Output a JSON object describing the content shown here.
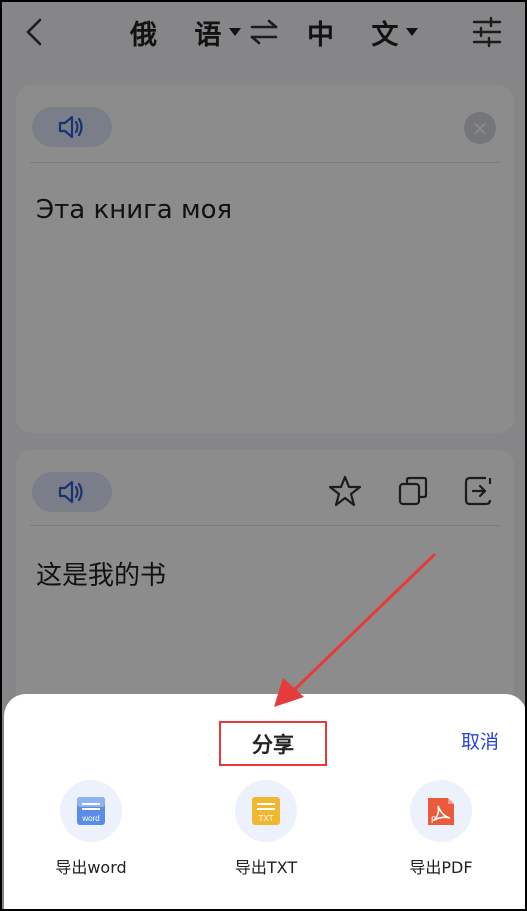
{
  "header": {
    "source_lang": "俄 语",
    "target_lang": "中 文"
  },
  "source": {
    "text": "Эта книга моя",
    "clear_symbol": "×"
  },
  "target": {
    "text": "这是我的书"
  },
  "share_sheet": {
    "title": "分享",
    "cancel": "取消",
    "options": [
      {
        "label": "导出word",
        "badge": "word",
        "color": "#5b8de8"
      },
      {
        "label": "导出TXT",
        "badge": "TXT",
        "color": "#f0b731"
      },
      {
        "label": "导出PDF",
        "badge": "P",
        "color": "#ea5a3c"
      }
    ]
  },
  "colors": {
    "accent": "#2a44d8",
    "highlight_box": "#e53b3b",
    "arrow": "#e53b3b"
  }
}
